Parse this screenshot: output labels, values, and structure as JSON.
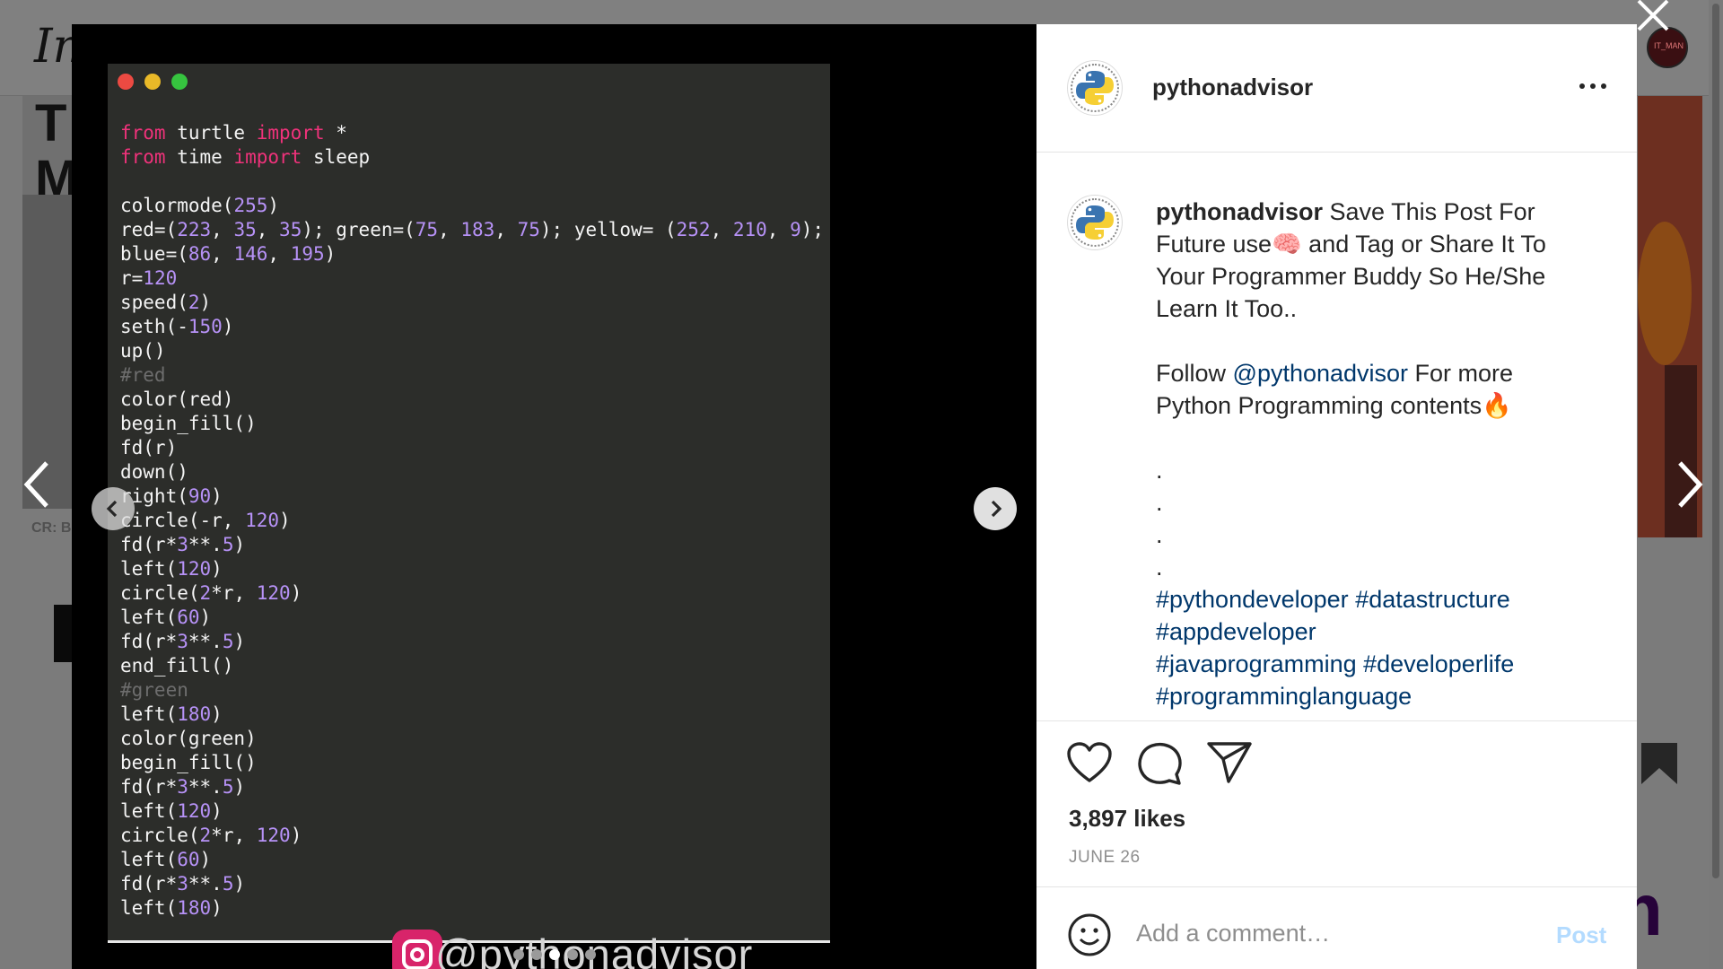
{
  "background": {
    "logo_text": "In",
    "left_card_text": "T\nM",
    "left_card_credit": "CR: B",
    "right_avatar_text": "IT_MAN",
    "right_card_letter": "m"
  },
  "post": {
    "username": "pythonadvisor",
    "code_lines": [
      [
        [
          "kw",
          "from"
        ],
        [
          "t",
          " turtle "
        ],
        [
          "kw",
          "import"
        ],
        [
          "t",
          " *"
        ]
      ],
      [
        [
          "kw",
          "from"
        ],
        [
          "t",
          " time "
        ],
        [
          "kw",
          "import"
        ],
        [
          "t",
          " sleep"
        ]
      ],
      [],
      [
        [
          "t",
          "colormode("
        ],
        [
          "num",
          "255"
        ],
        [
          "t",
          ")"
        ]
      ],
      [
        [
          "t",
          "red=("
        ],
        [
          "num",
          "223"
        ],
        [
          "t",
          ", "
        ],
        [
          "num",
          "35"
        ],
        [
          "t",
          ", "
        ],
        [
          "num",
          "35"
        ],
        [
          "t",
          "); green=("
        ],
        [
          "num",
          "75"
        ],
        [
          "t",
          ", "
        ],
        [
          "num",
          "183"
        ],
        [
          "t",
          ", "
        ],
        [
          "num",
          "75"
        ],
        [
          "t",
          "); yellow= ("
        ],
        [
          "num",
          "252"
        ],
        [
          "t",
          ", "
        ],
        [
          "num",
          "210"
        ],
        [
          "t",
          ", "
        ],
        [
          "num",
          "9"
        ],
        [
          "t",
          ");"
        ]
      ],
      [
        [
          "t",
          "blue=("
        ],
        [
          "num",
          "86"
        ],
        [
          "t",
          ", "
        ],
        [
          "num",
          "146"
        ],
        [
          "t",
          ", "
        ],
        [
          "num",
          "195"
        ],
        [
          "t",
          ")"
        ]
      ],
      [
        [
          "t",
          "r="
        ],
        [
          "num",
          "120"
        ]
      ],
      [
        [
          "t",
          "speed("
        ],
        [
          "num",
          "2"
        ],
        [
          "t",
          ")"
        ]
      ],
      [
        [
          "t",
          "seth(-"
        ],
        [
          "num",
          "150"
        ],
        [
          "t",
          ")"
        ]
      ],
      [
        [
          "t",
          "up()"
        ]
      ],
      [
        [
          "cm",
          "#red"
        ]
      ],
      [
        [
          "t",
          "color(red)"
        ]
      ],
      [
        [
          "t",
          "begin_fill()"
        ]
      ],
      [
        [
          "t",
          "fd(r)"
        ]
      ],
      [
        [
          "t",
          "down()"
        ]
      ],
      [
        [
          "t",
          "right("
        ],
        [
          "num",
          "90"
        ],
        [
          "t",
          ")"
        ]
      ],
      [
        [
          "t",
          "circle(-r, "
        ],
        [
          "num",
          "120"
        ],
        [
          "t",
          ")"
        ]
      ],
      [
        [
          "t",
          "fd(r*"
        ],
        [
          "num",
          "3"
        ],
        [
          "t",
          "**."
        ],
        [
          "num",
          "5"
        ],
        [
          "t",
          ")"
        ]
      ],
      [
        [
          "t",
          "left("
        ],
        [
          "num",
          "120"
        ],
        [
          "t",
          ")"
        ]
      ],
      [
        [
          "t",
          "circle("
        ],
        [
          "num",
          "2"
        ],
        [
          "t",
          "*r, "
        ],
        [
          "num",
          "120"
        ],
        [
          "t",
          ")"
        ]
      ],
      [
        [
          "t",
          "left("
        ],
        [
          "num",
          "60"
        ],
        [
          "t",
          ")"
        ]
      ],
      [
        [
          "t",
          "fd(r*"
        ],
        [
          "num",
          "3"
        ],
        [
          "t",
          "**."
        ],
        [
          "num",
          "5"
        ],
        [
          "t",
          ")"
        ]
      ],
      [
        [
          "t",
          "end_fill()"
        ]
      ],
      [
        [
          "cm",
          "#green"
        ]
      ],
      [
        [
          "t",
          "left("
        ],
        [
          "num",
          "180"
        ],
        [
          "t",
          ")"
        ]
      ],
      [
        [
          "t",
          "color(green)"
        ]
      ],
      [
        [
          "t",
          "begin_fill()"
        ]
      ],
      [
        [
          "t",
          "fd(r*"
        ],
        [
          "num",
          "3"
        ],
        [
          "t",
          "**."
        ],
        [
          "num",
          "5"
        ],
        [
          "t",
          ")"
        ]
      ],
      [
        [
          "t",
          "left("
        ],
        [
          "num",
          "120"
        ],
        [
          "t",
          ")"
        ]
      ],
      [
        [
          "t",
          "circle("
        ],
        [
          "num",
          "2"
        ],
        [
          "t",
          "*r, "
        ],
        [
          "num",
          "120"
        ],
        [
          "t",
          ")"
        ]
      ],
      [
        [
          "t",
          "left("
        ],
        [
          "num",
          "60"
        ],
        [
          "t",
          ")"
        ]
      ],
      [
        [
          "t",
          "fd(r*"
        ],
        [
          "num",
          "3"
        ],
        [
          "t",
          "**."
        ],
        [
          "num",
          "5"
        ],
        [
          "t",
          ")"
        ]
      ],
      [
        [
          "t",
          "left("
        ],
        [
          "num",
          "180"
        ],
        [
          "t",
          ")"
        ]
      ]
    ],
    "watermark": "@pythonadvisor",
    "carousel": {
      "count": 5,
      "active_index": 2
    },
    "caption": {
      "lines": [
        {
          "type": "rich",
          "parts": [
            [
              "user",
              "pythonadvisor"
            ],
            [
              "t",
              " Save This Post For"
            ]
          ]
        },
        {
          "type": "rich",
          "parts": [
            [
              "t",
              "Future use🧠 and Tag or Share It To"
            ]
          ]
        },
        {
          "type": "rich",
          "parts": [
            [
              "t",
              "Your Programmer Buddy So He/She"
            ]
          ]
        },
        {
          "type": "rich",
          "parts": [
            [
              "t",
              "Learn It Too.."
            ]
          ]
        },
        {
          "type": "blank"
        },
        {
          "type": "rich",
          "parts": [
            [
              "t",
              "Follow "
            ],
            [
              "link",
              "@pythonadvisor"
            ],
            [
              "t",
              " For more"
            ]
          ]
        },
        {
          "type": "rich",
          "parts": [
            [
              "t",
              "Python Programming contents🔥"
            ]
          ]
        },
        {
          "type": "blank"
        },
        {
          "type": "rich",
          "parts": [
            [
              "t",
              "."
            ]
          ]
        },
        {
          "type": "rich",
          "parts": [
            [
              "t",
              "."
            ]
          ]
        },
        {
          "type": "rich",
          "parts": [
            [
              "t",
              "."
            ]
          ]
        },
        {
          "type": "rich",
          "parts": [
            [
              "t",
              "."
            ]
          ]
        },
        {
          "type": "rich",
          "parts": [
            [
              "link",
              "#pythondeveloper"
            ],
            [
              "t",
              " "
            ],
            [
              "link",
              "#datastructure"
            ]
          ]
        },
        {
          "type": "rich",
          "parts": [
            [
              "link",
              "#appdeveloper"
            ]
          ]
        },
        {
          "type": "rich",
          "parts": [
            [
              "link",
              "#javaprogramming"
            ],
            [
              "t",
              " "
            ],
            [
              "link",
              "#developerlife"
            ]
          ]
        },
        {
          "type": "rich",
          "parts": [
            [
              "link",
              "#programminglanguage"
            ]
          ]
        }
      ]
    },
    "likes": "3,897 likes",
    "date": "JUNE 26",
    "comment": {
      "placeholder": "Add a comment…",
      "post_label": "Post"
    }
  },
  "colors": {
    "overlay": "#7f7f7f",
    "code_bg": "#2c2d2a",
    "keyword": "#f0327b",
    "number": "#b792f7",
    "link": "#00376b",
    "post_disabled": "#b3dbff"
  }
}
